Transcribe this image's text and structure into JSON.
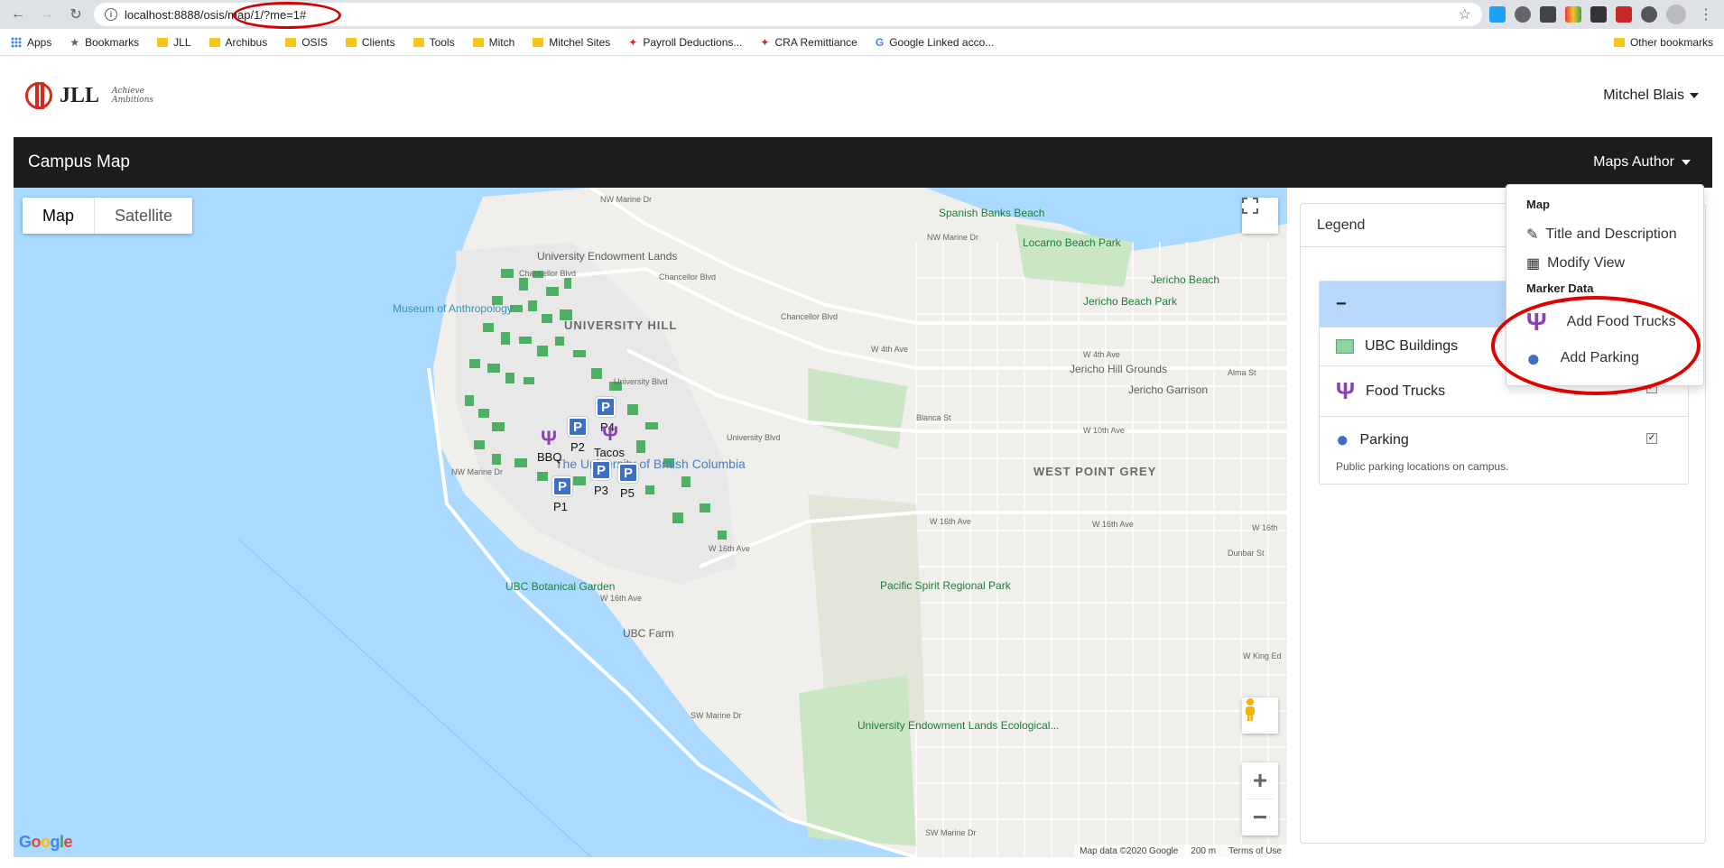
{
  "browser": {
    "url": "localhost:8888/osis/map/1/?me=1#",
    "bookmarks": [
      "Apps",
      "Bookmarks",
      "JLL",
      "Archibus",
      "OSIS",
      "Clients",
      "Tools",
      "Mitch",
      "Mitchel Sites",
      "Payroll Deductions...",
      "CRA Remittiance",
      "Google Linked acco..."
    ],
    "other_bookmarks": "Other bookmarks"
  },
  "app": {
    "logo_text": "JLL",
    "logo_tagline_1": "Achieve",
    "logo_tagline_2": "Ambitions",
    "user_name": "Mitchel Blais"
  },
  "navbar": {
    "title": "Campus Map",
    "author_menu": "Maps Author"
  },
  "map": {
    "type_map": "Map",
    "type_satellite": "Satellite",
    "google": "Google",
    "footer_data": "Map data ©2020 Google",
    "footer_scale": "200 m",
    "footer_terms": "Terms of Use",
    "places": {
      "spanish_banks": "Spanish Banks Beach",
      "locarno": "Locarno Beach Park",
      "jericho_beach": "Jericho Beach",
      "jericho_beach_park": "Jericho Beach Park",
      "endowment_lands": "University Endowment Lands",
      "museum": "Museum of Anthropology",
      "university_hill": "UNIVERSITY HILL",
      "jericho_hill": "Jericho Hill Grounds",
      "jericho_garrison": "Jericho Garrison",
      "west_point_grey": "WEST POINT GREY",
      "ubc_botanical": "UBC Botanical Garden",
      "ubc_farm": "UBC Farm",
      "pacific_spirit": "Pacific Spirit Regional Park",
      "ubc_ecological": "University Endowment Lands Ecological...",
      "ubc_name": "The University of British Columbia"
    },
    "streets": {
      "nw_marine_top": "NW Marine Dr",
      "nw_marine_2": "NW Marine Dr",
      "chancellor_1": "Chancellor Blvd",
      "chancellor_2": "Chancellor Blvd",
      "chancellor_3": "Chancellor Blvd",
      "university_blvd": "University Blvd",
      "university_blvd_2": "University Blvd",
      "w4th_1": "W 4th Ave",
      "w4th_2": "W 4th Ave",
      "w10th": "W 10th Ave",
      "w16th_1": "W 16th Ave",
      "w16th_2": "W 16th Ave",
      "w16th_3": "W 16th",
      "w16th_4": "W 16th Ave",
      "w16th_5": "W 16th Ave",
      "nw_marine_left": "NW Marine Dr",
      "sw_marine_1": "SW Marine Dr",
      "sw_marine_2": "SW Marine Dr",
      "blanca": "Blanca St",
      "dunbar": "Dunbar St",
      "alma": "Alma St",
      "w_king_ed": "W King Ed"
    },
    "markers": [
      {
        "label": "P1"
      },
      {
        "label": "P2"
      },
      {
        "label": "P3"
      },
      {
        "label": "P4"
      },
      {
        "label": "P5"
      },
      {
        "label": "BBQ"
      },
      {
        "label": "Tacos"
      }
    ]
  },
  "legend": {
    "title": "Legend",
    "toggle": "−",
    "items": [
      {
        "label": "UBC Buildings"
      },
      {
        "label": "Food Trucks"
      },
      {
        "label": "Parking",
        "description": "Public parking locations on campus."
      }
    ]
  },
  "dropdown": {
    "section_map": "Map",
    "title_desc": "Title and Description",
    "modify_view": "Modify View",
    "section_marker": "Marker Data",
    "add_food_trucks": "Add Food Trucks",
    "add_parking": "Add Parking"
  },
  "colors": {
    "navbar": "#1d1d1d",
    "water": "#aadaff",
    "parking_marker": "#3d6fc4",
    "food_marker": "#8e3fb3",
    "annotation_red": "#e00000"
  }
}
